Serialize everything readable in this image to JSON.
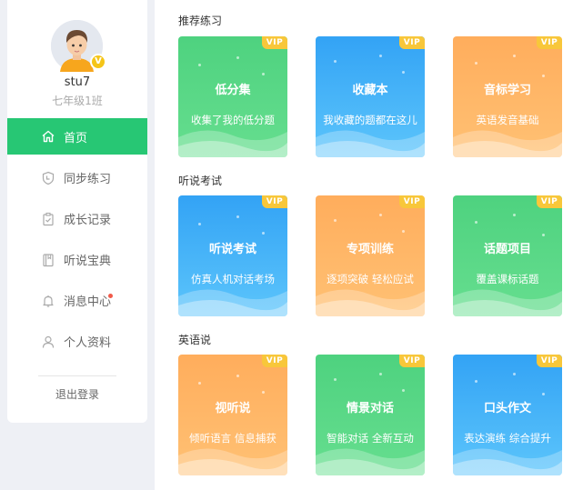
{
  "user": {
    "name": "stu7",
    "class": "七年级1班"
  },
  "nav": [
    {
      "label": "首页",
      "icon": "home-icon",
      "active": true
    },
    {
      "label": "同步练习",
      "icon": "shield-icon"
    },
    {
      "label": "成长记录",
      "icon": "clipboard-check-icon"
    },
    {
      "label": "听说宝典",
      "icon": "book-icon"
    },
    {
      "label": "消息中心",
      "icon": "bell-icon",
      "badge": true
    },
    {
      "label": "个人资料",
      "icon": "user-icon"
    }
  ],
  "logout": "退出登录",
  "vip_label": "VIP",
  "sections": [
    {
      "title": "推荐练习",
      "cards": [
        {
          "title": "低分集",
          "subtitle": "收集了我的低分题",
          "color": "green"
        },
        {
          "title": "收藏本",
          "subtitle": "我收藏的题都在这儿",
          "color": "blue"
        },
        {
          "title": "音标学习",
          "subtitle": "英语发音基础",
          "color": "orange"
        }
      ]
    },
    {
      "title": "听说考试",
      "cards": [
        {
          "title": "听说考试",
          "subtitle": "仿真人机对话考场",
          "color": "blue"
        },
        {
          "title": "专项训练",
          "subtitle": "逐项突破 轻松应试",
          "color": "orange"
        },
        {
          "title": "话题项目",
          "subtitle": "覆盖课标话题",
          "color": "green"
        }
      ]
    },
    {
      "title": "英语说",
      "cards": [
        {
          "title": "视听说",
          "subtitle": "倾听语言 信息捕获",
          "color": "orange"
        },
        {
          "title": "情景对话",
          "subtitle": "智能对话 全新互动",
          "color": "green"
        },
        {
          "title": "口头作文",
          "subtitle": "表达演练 综合提升",
          "color": "blue"
        }
      ]
    }
  ],
  "colors": {
    "accent": "#27c774",
    "green": "#4ed27f",
    "blue": "#33a3f5",
    "orange": "#ffad5c",
    "vip": "#f8c73a"
  }
}
